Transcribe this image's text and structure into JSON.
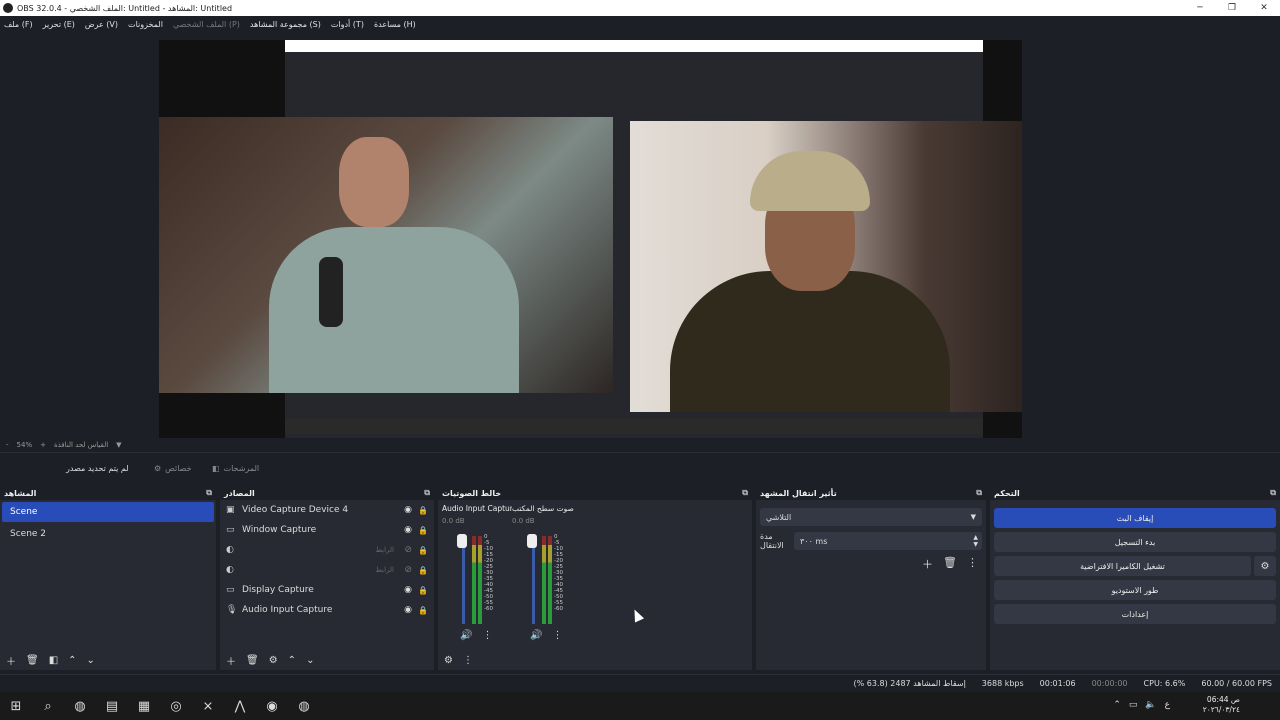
{
  "window": {
    "title": "OBS 32.0.4 - الملف الشخصي: Untitled - المشاهد: Untitled",
    "min": "─",
    "max": "❐",
    "close": "✕"
  },
  "menu": [
    "ملف (F)",
    "تحرير (E)",
    "عرض (V)",
    "المخزونات",
    "الملف الشخصي (P)",
    "مجموعة المشاهد (S)",
    "أدوات (T)",
    "مساعدة (H)"
  ],
  "zoom": {
    "minus": "-",
    "value": "54%",
    "plus": "+",
    "label": "القياس لحد النافذة"
  },
  "source_toolbar": {
    "no_source": "لم يتم تحديد مصدر",
    "properties": "خصائص",
    "filters": "المرشحات"
  },
  "scenes": {
    "title": "المشاهد",
    "items": [
      "Scene",
      "Scene 2"
    ]
  },
  "sources": {
    "title": "المصادر",
    "items": [
      {
        "name": "Video Capture Device 4",
        "icon": "camera-icon"
      },
      {
        "name": "Window Capture",
        "icon": "window-icon"
      },
      {
        "name": "",
        "icon": "browser-icon",
        "hidden_label": "الرابط"
      },
      {
        "name": "",
        "icon": "browser-icon",
        "hidden_label": "الرابط"
      },
      {
        "name": "Display Capture",
        "icon": "monitor-icon"
      },
      {
        "name": "Audio Input Capture",
        "icon": "mic-icon"
      }
    ]
  },
  "mixer": {
    "title": "خالط الصوتيات",
    "channels": [
      {
        "name": "Audio Input Captur",
        "db": "0.0 dB"
      },
      {
        "name": "صوت سطح المكتب",
        "db": "0.0 dB"
      }
    ],
    "scale": [
      "0",
      "-5",
      "-10",
      "-15",
      "-20",
      "-25",
      "-30",
      "-35",
      "-40",
      "-45",
      "-50",
      "-55",
      "-60"
    ]
  },
  "transitions": {
    "title": "تأثير انتقال المشهد",
    "selected": "التلاشي",
    "duration_label": "مدة الانتقال",
    "duration_value": "٣٠٠ ms"
  },
  "controls": {
    "title": "التحكم",
    "stop_stream": "إيقاف البث",
    "start_record": "بدء التسجيل",
    "virtual_cam": "تشغيل الكاميرا الافتراضية",
    "studio_mode": "طور الاستوديو",
    "settings": "إعدادات"
  },
  "status": {
    "dropped": "إسقاط المشاهد 2487 (63.8 %)",
    "bitrate": "3688 kbps",
    "stream_time": "00:01:06",
    "rec_time": "00:00:00",
    "cpu": "CPU: 6.6%",
    "fps": "60.00 / 60.00 FPS"
  },
  "taskbar": {
    "time": "06:44 ص",
    "date": "٢٠٢٦/٠٣/٢٤",
    "lang": "ع"
  }
}
